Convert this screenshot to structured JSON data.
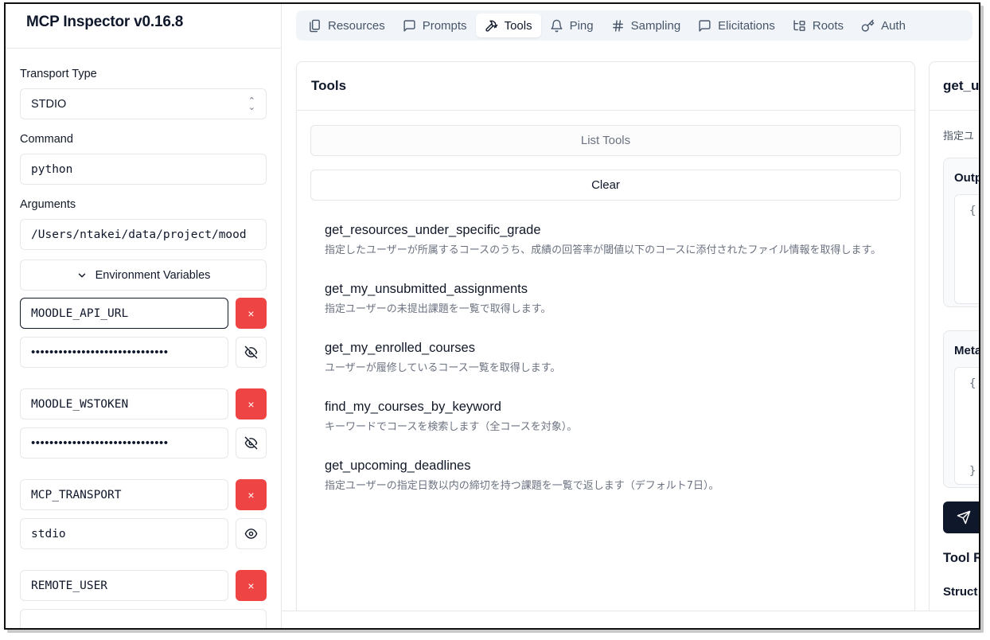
{
  "app": {
    "title": "MCP Inspector v0.16.8"
  },
  "sidebar": {
    "transport_label": "Transport Type",
    "transport_value": "STDIO",
    "command_label": "Command",
    "command_value": "python",
    "arguments_label": "Arguments",
    "arguments_value": "/Users/ntakei/data/project/mood",
    "env_button": "Environment Variables",
    "delete_glyph": "×",
    "env": [
      {
        "key": "MOODLE_API_URL",
        "value": "••••••••••••••••••••••••••••••",
        "masked": true
      },
      {
        "key": "MOODLE_WSTOKEN",
        "value": "••••••••••••••••••••••••••••••",
        "masked": true
      },
      {
        "key": "MCP_TRANSPORT",
        "value": "stdio",
        "masked": false
      },
      {
        "key": "REMOTE_USER",
        "value": "",
        "masked": true
      }
    ]
  },
  "tabs": [
    {
      "label": "Resources",
      "icon": "resources-icon"
    },
    {
      "label": "Prompts",
      "icon": "message-icon"
    },
    {
      "label": "Tools",
      "icon": "hammer-icon",
      "active": true
    },
    {
      "label": "Ping",
      "icon": "bell-icon"
    },
    {
      "label": "Sampling",
      "icon": "hash-icon"
    },
    {
      "label": "Elicitations",
      "icon": "message-icon"
    },
    {
      "label": "Roots",
      "icon": "folder-tree-icon"
    },
    {
      "label": "Auth",
      "icon": "key-icon"
    }
  ],
  "tools_panel": {
    "title": "Tools",
    "list_button": "List Tools",
    "clear_button": "Clear",
    "tools": [
      {
        "name": "get_resources_under_specific_grade",
        "description": "指定したユーザーが所属するコースのうち、成績の回答率が閾値以下のコースに添付されたファイル情報を取得します。"
      },
      {
        "name": "get_my_unsubmitted_assignments",
        "description": "指定ユーザーの未提出課題を一覧で取得します。"
      },
      {
        "name": "get_my_enrolled_courses",
        "description": "ユーザーが履修しているコース一覧を取得します。"
      },
      {
        "name": "find_my_courses_by_keyword",
        "description": "キーワードでコースを検索します（全コースを対象）。"
      },
      {
        "name": "get_upcoming_deadlines",
        "description": "指定ユーザーの指定日数以内の締切を持つ課題を一覧で返します（デフォルト7日）。"
      }
    ]
  },
  "detail_panel": {
    "title": "get_u",
    "description": "指定ユ",
    "output_title": "Outp",
    "output_open": "{",
    "meta_title": "Meta",
    "meta_open": "{",
    "meta_close": "}",
    "tool_result_title": "Tool R",
    "structured_title": "Struct"
  },
  "colors": {
    "danger": "#ef4444",
    "primary_dark": "#0f172a",
    "muted": "#6b7280"
  }
}
